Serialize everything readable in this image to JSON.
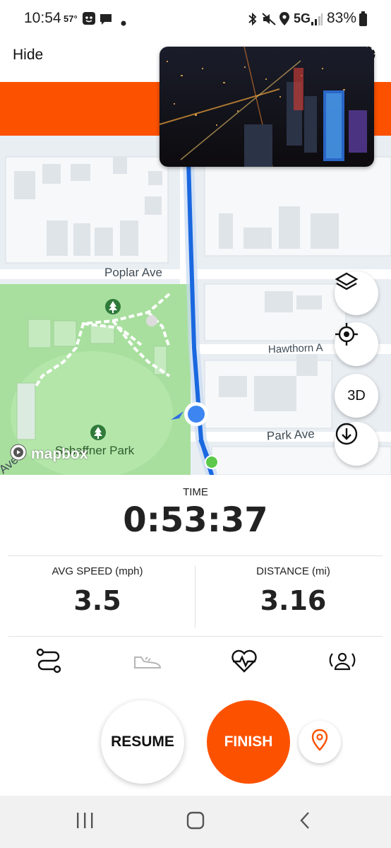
{
  "status_bar": {
    "time": "10:54",
    "temperature": "57°",
    "network": "5G",
    "battery": "83%",
    "icons": [
      "app-notification-icon",
      "chat-bubble-icon",
      "dot-icon",
      "bluetooth-icon",
      "mute-icon",
      "location-icon",
      "signal-icon",
      "battery-icon"
    ]
  },
  "header": {
    "hide_label": "Hide",
    "accent_color": "#fc5200"
  },
  "map": {
    "street_labels": {
      "poplar": "Poplar Ave",
      "hawthorn": "Hawthorn A",
      "park": "Park Ave",
      "park_name": "Schaffner Park",
      "edge": "Ave"
    },
    "controls": {
      "layers_icon": "layers-icon",
      "recenter_icon": "crosshair-icon",
      "three_d_label": "3D",
      "download_icon": "download-icon"
    },
    "attribution": "mapbox"
  },
  "stats": {
    "time_label": "TIME",
    "time_value": "0:53:37",
    "avg_speed_label": "AVG SPEED (mph)",
    "avg_speed_value": "3.5",
    "distance_label": "DISTANCE (mi)",
    "distance_value": "3.16"
  },
  "tabs": [
    "route-icon",
    "shoe-icon",
    "heart-rate-icon",
    "beacon-icon"
  ],
  "actions": {
    "resume_label": "RESUME",
    "finish_label": "FINISH",
    "pin_icon": "location-pin-icon"
  },
  "nav": [
    "recent-apps-icon",
    "home-icon",
    "back-icon"
  ]
}
